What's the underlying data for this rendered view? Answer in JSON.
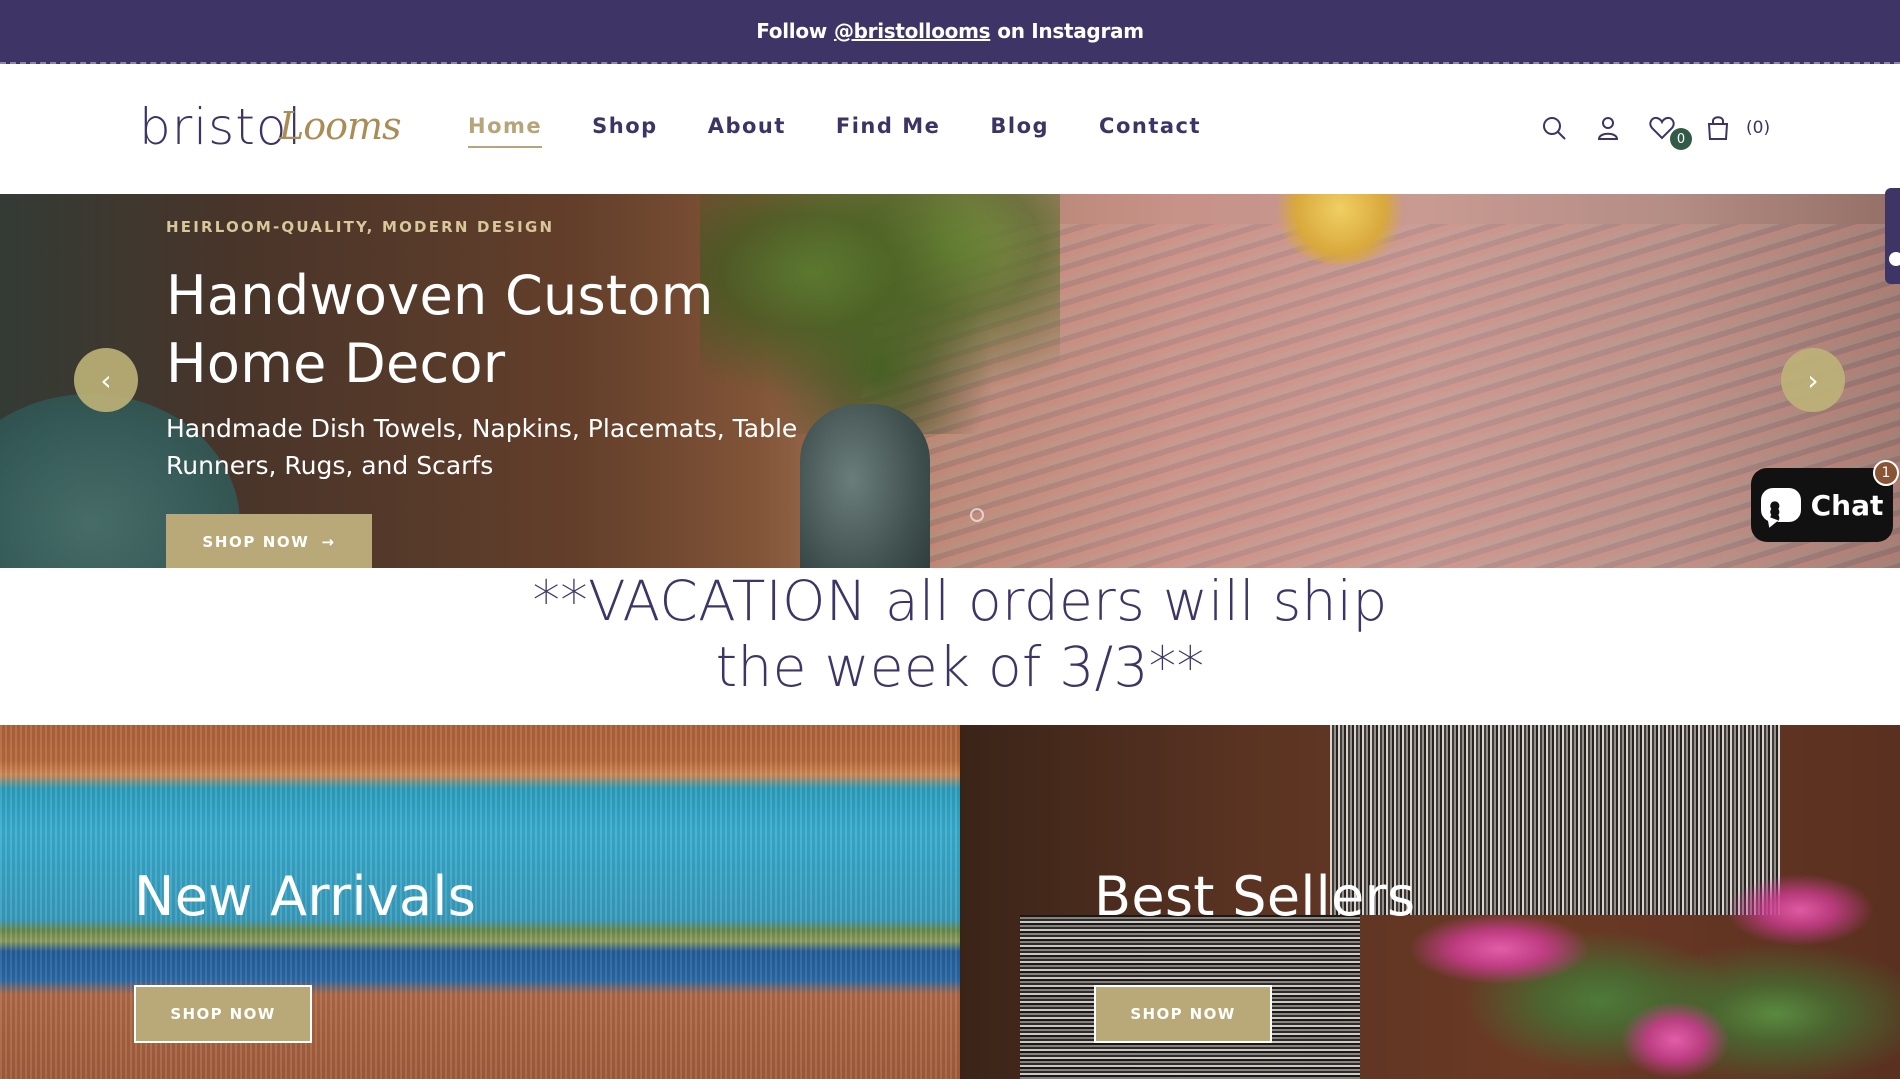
{
  "announcement": {
    "prefix": "Follow",
    "handle": "@bristollooms",
    "suffix": "on Instagram"
  },
  "logo": {
    "primary": "bristol",
    "secondary": "Looms"
  },
  "nav": {
    "items": [
      {
        "label": "Home",
        "active": true
      },
      {
        "label": "Shop"
      },
      {
        "label": "About"
      },
      {
        "label": "Find Me"
      },
      {
        "label": "Blog"
      },
      {
        "label": "Contact"
      }
    ]
  },
  "header_icons": {
    "search": "search-icon",
    "account": "user-icon",
    "wishlist": "heart-icon",
    "wishlist_count": "0",
    "cart": "bag-icon",
    "cart_count": "(0)"
  },
  "hero": {
    "eyebrow": "HEIRLOOM-QUALITY, MODERN DESIGN",
    "title": "Handwoven Custom Home Decor",
    "subtitle": "Handmade Dish Towels, Napkins, Placemats, Table Runners, Rugs, and Scarfs",
    "button_label": "SHOP NOW",
    "button_arrow": "→",
    "prev_arrow": "‹",
    "next_arrow": "›"
  },
  "notice": {
    "text": "**VACATION all orders will ship the week of 3/3**"
  },
  "collections": [
    {
      "title": "New Arrivals",
      "button_label": "SHOP NOW"
    },
    {
      "title": "Best Sellers",
      "button_label": "SHOP NOW"
    }
  ],
  "chat": {
    "label": "Chat",
    "badge": "1"
  },
  "colors": {
    "brand_purple": "#3e3566",
    "accent_gold": "#b9a878",
    "wishlist_badge": "#335a47"
  }
}
